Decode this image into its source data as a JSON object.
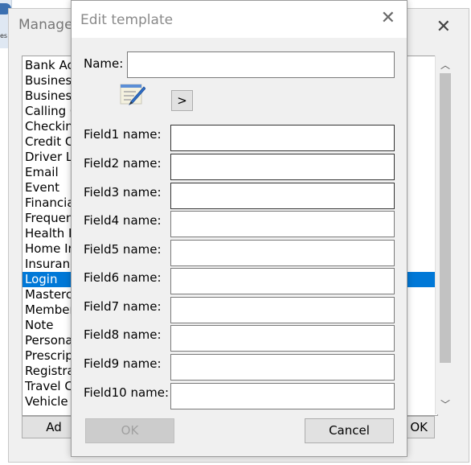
{
  "manage_dialog": {
    "title": "Manage",
    "close_glyph": "✕",
    "items": [
      "Bank Ac",
      "Business",
      "Business",
      "Calling C",
      "Checking",
      "Credit C",
      "Driver Li",
      "Email",
      "Event",
      "Financia",
      "Frequen",
      "Health I",
      "Home Ir",
      "Insuranc",
      "Login",
      "Masterca",
      "Member",
      "Note",
      "Personal",
      "Prescript",
      "Registrat",
      "Travel C",
      "Vehicle I"
    ],
    "selected_index": 14,
    "left_button_label": "Ad",
    "ok_label": "OK"
  },
  "edit_dialog": {
    "title": "Edit template",
    "close_glyph": "✕",
    "name_label": "Name:",
    "name_value": "",
    "pencil_icon": "pencil-icon",
    "arrow_label": ">",
    "fields": [
      {
        "label": "Field1 name:",
        "value": ""
      },
      {
        "label": "Field2 name:",
        "value": ""
      },
      {
        "label": "Field3 name:",
        "value": ""
      },
      {
        "label": "Field4 name:",
        "value": ""
      },
      {
        "label": "Field5 name:",
        "value": ""
      },
      {
        "label": "Field6 name:",
        "value": ""
      },
      {
        "label": "Field7 name:",
        "value": ""
      },
      {
        "label": "Field8 name:",
        "value": ""
      },
      {
        "label": "Field9 name:",
        "value": ""
      },
      {
        "label": "Field10 name:",
        "value": ""
      }
    ],
    "ok_label": "OK",
    "cancel_label": "Cancel"
  },
  "colors": {
    "selection": "#0078d7",
    "dialog_bg": "#f0f0f0"
  }
}
